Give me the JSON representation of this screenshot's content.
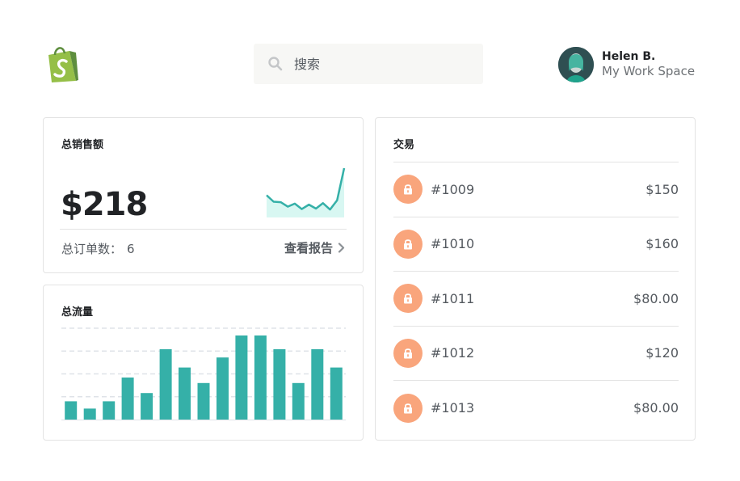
{
  "header": {
    "logo_icon": "shopify-bag-icon",
    "search": {
      "placeholder": "搜索"
    },
    "profile": {
      "name": "Helen B.",
      "workspace": "My Work Space"
    }
  },
  "sales_card": {
    "title": "总销售额",
    "total": "$218",
    "orders_label": "总订单数：",
    "orders_count": "6",
    "report_link": "查看报告",
    "sparkline_values": [
      4.5,
      3.2,
      3.1,
      2.2,
      2.8,
      1.7,
      2.6,
      1.8,
      2.9,
      1.6,
      3.5,
      10.0
    ]
  },
  "traffic_card": {
    "title": "总流量",
    "chart_data": {
      "type": "bar",
      "values": [
        20,
        12,
        20,
        46,
        29,
        77,
        57,
        40,
        68,
        92,
        92,
        77,
        40,
        77,
        57
      ]
    }
  },
  "transactions_card": {
    "title": "交易",
    "rows": [
      {
        "id": "#1009",
        "amount": "$150"
      },
      {
        "id": "#1010",
        "amount": "$160"
      },
      {
        "id": "#1011",
        "amount": "$80.00"
      },
      {
        "id": "#1012",
        "amount": "$120"
      },
      {
        "id": "#1013",
        "amount": "$80.00"
      }
    ]
  },
  "colors": {
    "accent_teal": "#35b0a8",
    "sparkline_fill": "#d8f7f2",
    "lock_badge": "#f9a57c",
    "logo_green": "#95bf47"
  }
}
